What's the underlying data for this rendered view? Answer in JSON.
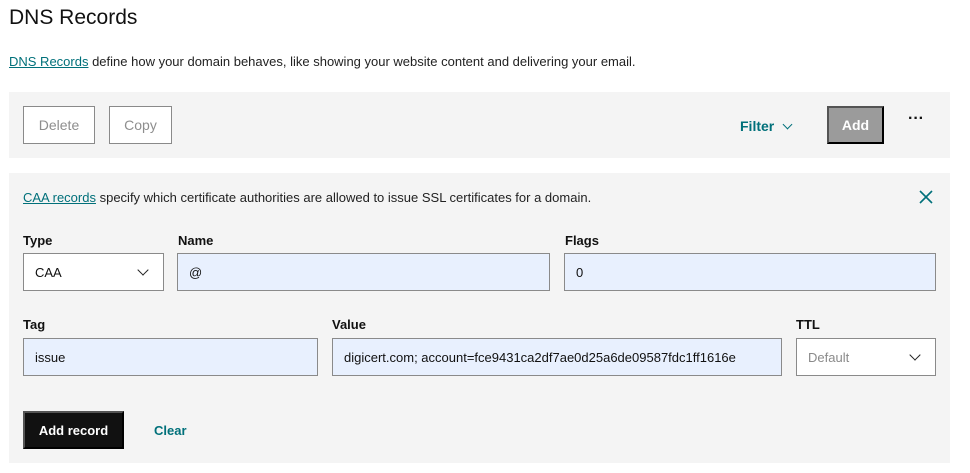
{
  "page": {
    "title": "DNS Records",
    "intro_link": "DNS Records",
    "intro_text": " define how your domain behaves, like showing your website content and delivering your email."
  },
  "toolbar": {
    "delete_label": "Delete",
    "copy_label": "Copy",
    "filter_label": "Filter",
    "add_label": "Add",
    "more_label": "···"
  },
  "panel": {
    "info_link": "CAA records",
    "info_text": " specify which certificate authorities are allowed to issue SSL certificates for a domain.",
    "close_icon": "close-icon",
    "type": {
      "label": "Type",
      "value": "CAA"
    },
    "name": {
      "label": "Name",
      "value": "@"
    },
    "flags": {
      "label": "Flags",
      "value": "0"
    },
    "tag": {
      "label": "Tag",
      "value": "issue"
    },
    "value": {
      "label": "Value",
      "value": "digicert.com; account=fce9431ca2df7ae0d25a6de09587fdc1ff1616e"
    },
    "ttl": {
      "label": "TTL",
      "value": "Default"
    },
    "add_record_label": "Add record",
    "clear_label": "Clear"
  },
  "colors": {
    "accent": "#00707a",
    "filled_field": "#e8f0fe",
    "panel_bg": "#f4f4f4",
    "disabled_button": "#9b9b9b"
  }
}
